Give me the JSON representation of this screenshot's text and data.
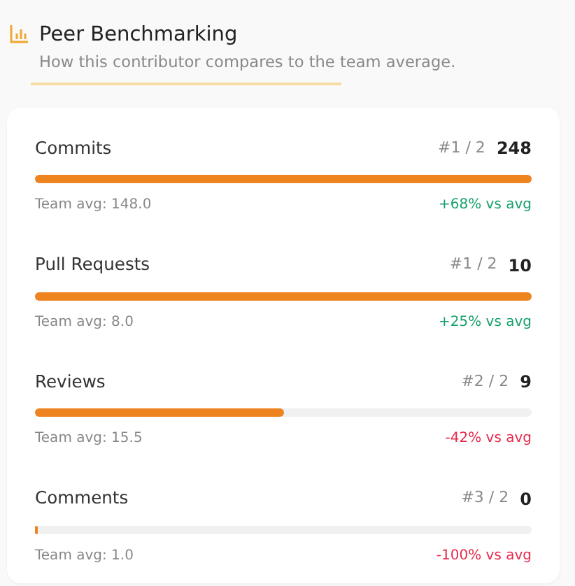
{
  "header": {
    "title": "Peer Benchmarking",
    "subtitle": "How this contributor compares to the team average."
  },
  "metrics": [
    {
      "name": "Commits",
      "rank": "#1 / 2",
      "value": "248",
      "level": 1,
      "team_avg": "Team avg: 148.0",
      "delta": "+68% vs avg",
      "color": "#16a06a"
    },
    {
      "name": "Pull Requests",
      "rank": "#1 / 2",
      "value": "10",
      "level": 1,
      "team_avg": "Team avg: 8.0",
      "delta": "+25% vs avg",
      "color": "#16a06a"
    },
    {
      "name": "Reviews",
      "rank": "#2 / 2",
      "value": "9",
      "level": 0.5,
      "team_avg": "Team avg: 15.5",
      "delta": "-42% vs avg",
      "color": "#e8294c"
    },
    {
      "name": "Comments",
      "rank": "#3 / 2",
      "value": "0",
      "level": 0.005,
      "team_avg": "Team avg: 1.0",
      "delta": "-100% vs avg",
      "color": "#e8294c"
    }
  ]
}
